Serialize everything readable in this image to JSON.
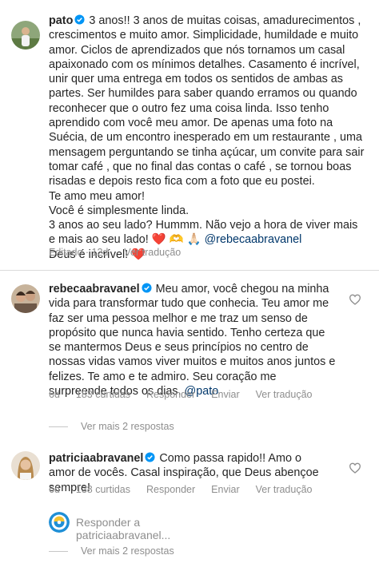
{
  "comments": [
    {
      "username": "pato",
      "paragraphs": [
        "3 anos!! 3 anos de muitas coisas, amadurecimentos , crescimentos e muito amor. Simplicidade, humildade e muito amor. Ciclos de aprendizados que nós tornamos um casal apaixonado com os mínimos detalhes. Casamento é incrível, unir quer uma entrega em todos os sentidos de ambas as partes. Ser humildes para saber quando erramos ou quando reconhecer que o outro fez uma coisa linda. Isso tenho aprendido com você meu amor. De apenas uma foto na Suécia, de um encontro inesperado em um restaurante , uma mensagem perguntando se tinha açúcar, um convite para sair tomar café , que no final das contas o café , se tornou boas risadas e depois resto fica com a foto que eu postei.",
        "Te amo meu amor!",
        "Você é simplesmente linda.",
        "3 anos ao seu lado? Hummm. Não vejo a hora de viver mais e mais ao seu lado!"
      ],
      "emojis_line": "❤️ 🫶 🙏🏻",
      "mention": "@rebecaabravanel",
      "closing": "Deus é incrível!",
      "closing_emoji": "❤️",
      "edited": "Editado",
      "time": "12d",
      "translate": "Ver tradução"
    },
    {
      "username": "rebecaabravanel",
      "text": "Meu amor, você chegou na minha vida para transformar tudo que conhecia. Teu amor me faz ser uma pessoa melhor e me traz um senso de propósito que nunca havia sentido. Tenho certeza que se mantermos Deus e seus princípios no centro de nossas vidas vamos viver muitos e muitos anos juntos e felizes. Te amo e te admiro. Seu coração me surpreende todos os dias.",
      "mention": "@pato",
      "time": "6d",
      "likes": "183 curtidas",
      "reply": "Responder",
      "send": "Enviar",
      "translate": "Ver tradução",
      "view_more": "Ver mais 2 respostas"
    },
    {
      "username": "patriciaabravanel",
      "text": "Como passa rapido!! Amo o amor de vocês. Casal inspiração, que Deus abençoe sempre!",
      "time": "6d",
      "likes": "138 curtidas",
      "reply": "Responder",
      "send": "Enviar",
      "translate": "Ver tradução",
      "reply_placeholder": "Responder a patriciaabravanel...",
      "view_more": "Ver mais 2 respostas"
    }
  ],
  "colors": {
    "verified": "#0095f6",
    "secondary": "#8e8e8e",
    "mention": "#00376b",
    "heart": "#ed4956"
  }
}
